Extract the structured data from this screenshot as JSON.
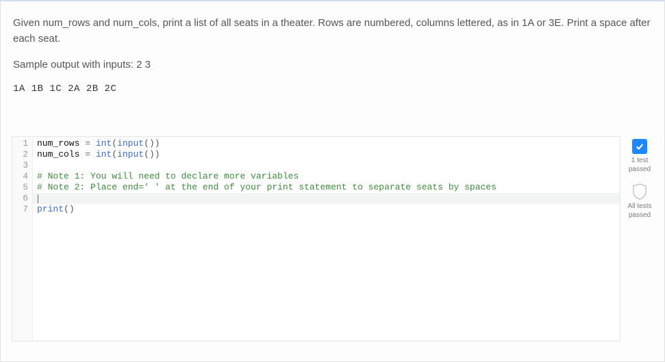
{
  "problem": {
    "description": "Given num_rows and num_cols, print a list of all seats in a theater. Rows are numbered, columns lettered, as in 1A or 3E. Print a space after each seat.",
    "sample_intro": "Sample output with inputs: 2 3",
    "sample_output": "1A 1B 1C 2A 2B 2C"
  },
  "editor": {
    "line_numbers": [
      "1",
      "2",
      "3",
      "4",
      "5",
      "6",
      "7"
    ],
    "lines": {
      "l1": {
        "id1": "num_rows",
        "op": " = ",
        "fn": "int",
        "par1": "(",
        "fn2": "input",
        "par2": "())"
      },
      "l2": {
        "id1": "num_cols",
        "op": " = ",
        "fn": "int",
        "par1": "(",
        "fn2": "input",
        "par2": "())"
      },
      "l3": "",
      "l4": "# Note 1: You will need to declare more variables",
      "l5": "# Note 2: Place end=' ' at the end of your print statement to separate seats by spaces",
      "l6": "",
      "l7": {
        "fn": "print",
        "par": "()"
      }
    },
    "cursor_line": 6
  },
  "status": {
    "one_test": {
      "line1": "1 test",
      "line2": "passed"
    },
    "all_tests": {
      "line1": "All tests",
      "line2": "passed"
    }
  }
}
